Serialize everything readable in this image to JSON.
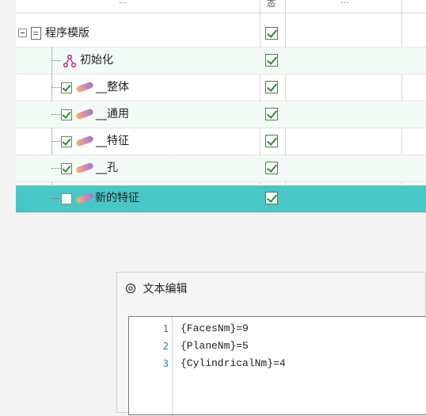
{
  "tree": {
    "header": {
      "state_label": "态",
      "col_left_hint": "...",
      "col_mid_hint": "..."
    },
    "rows": [
      {
        "label": "程序模版",
        "enabled": true
      },
      {
        "label": "初始化",
        "enabled": true
      },
      {
        "label": "__整体",
        "enabled": true,
        "checked": true
      },
      {
        "label": "__通用",
        "enabled": true,
        "checked": true
      },
      {
        "label": "__特征",
        "enabled": true,
        "checked": true
      },
      {
        "label": "__孔",
        "enabled": true,
        "checked": true
      },
      {
        "label": "新的特征",
        "enabled": true,
        "checked": false,
        "selected": true
      }
    ]
  },
  "editor": {
    "title": "文本编辑",
    "lines": [
      {
        "n": "1",
        "text": "{FacesNm}=9"
      },
      {
        "n": "2",
        "text": "{PlaneNm}=5"
      },
      {
        "n": "3",
        "text": "{CylindricalNm}=4"
      }
    ]
  },
  "colors": {
    "selected_row": "#49c6c6",
    "check_green": "#2e8b2e",
    "line_number": "#2b77c4"
  }
}
